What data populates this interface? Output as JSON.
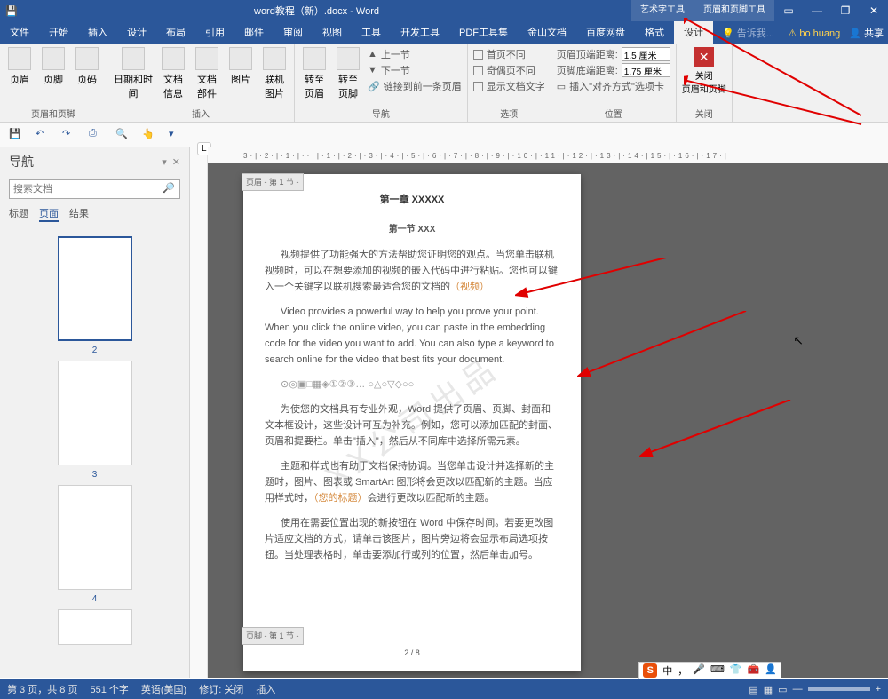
{
  "title": "word教程（新）.docx - Word",
  "contextual_tabs": [
    "艺术字工具",
    "页眉和页脚工具"
  ],
  "menu": [
    "文件",
    "开始",
    "插入",
    "设计",
    "布局",
    "引用",
    "邮件",
    "审阅",
    "视图",
    "工具",
    "开发工具",
    "PDF工具集",
    "金山文档",
    "百度网盘",
    "格式",
    "设计"
  ],
  "menu_active_index": 15,
  "tell_me_placeholder": "告诉我...",
  "user_name": "bo huang",
  "share_label": "共享",
  "ribbon": {
    "hf": {
      "header": "页眉",
      "footer": "页脚",
      "pagenum": "页码",
      "group": "页眉和页脚"
    },
    "insert": {
      "datetime": "日期和时间",
      "docinfo": "文档信息",
      "docpart": "文档部件",
      "picture": "图片",
      "online": "联机图片",
      "group": "插入"
    },
    "goto": {
      "gohdr": "转至页眉",
      "goftr": "转至页脚",
      "prev": "上一节",
      "next": "下一节",
      "link": "链接到前一条页眉",
      "group": "导航"
    },
    "options": {
      "first": "首页不同",
      "odd": "奇偶页不同",
      "showtxt": "显示文档文字",
      "align": "插入\"对齐方式\"选项卡",
      "group": "选项"
    },
    "position": {
      "top": "页眉顶端距离:",
      "bottom": "页脚底端距离:",
      "topv": "1.5 厘米",
      "botv": "1.75 厘米",
      "group": "位置"
    },
    "close": {
      "label": "关闭\n页眉和页脚",
      "group": "关闭"
    }
  },
  "nav": {
    "title": "导航",
    "search_placeholder": "搜索文档",
    "tabs": [
      "标题",
      "页面",
      "结果"
    ],
    "tabs_active": 1,
    "thumbs": [
      "2",
      "3",
      "4"
    ]
  },
  "ruler_badge": "L",
  "doc": {
    "header_section": "页眉 - 第 1 节 -",
    "footer_section": "页脚 - 第 1 节 -",
    "chapter": "第一章  XXXXX",
    "section": "第一节  XXX",
    "p1": "视频提供了功能强大的方法帮助您证明您的观点。当您单击联机视频时，可以在想要添加的视频的嵌入代码中进行粘贴。您也可以键入一个关键字以联机搜索最适合您的文档的",
    "p1_orange": "（视频）",
    "p2": "Video provides a powerful way to help you prove your point. When you click the online video, you can paste in the embedding code for the video you want to add. You can also type a keyword to search online for the video that best fits your document.",
    "symbols": "⊙◎▣□▦◈①②③…  ○△○▽◇○○",
    "p3": "为使您的文档具有专业外观，Word 提供了页眉、页脚、封面和文本框设计，这些设计可互为补充。例如，您可以添加匹配的封面、页眉和提要栏。单击\"插入\"，然后从不同库中选择所需元素。",
    "p4a": "主题和样式也有助于文档保持协调。当您单击设计并选择新的主题时，图片、图表或 SmartArt 图形将会更改以匹配新的主题。当应用样式时，",
    "p4_orange": "（您的标题）",
    "p4b": "会进行更改以匹配新的主题。",
    "p5": "使用在需要位置出现的新按钮在 Word 中保存时间。若要更改图片适应文档的方式，请单击该图片，图片旁边将会显示布局选项按钮。当处理表格时，单击要添加行或列的位置，然后单击加号。",
    "watermark": "XX公司出品",
    "ftr_page": "2 / 8"
  },
  "status": {
    "page": "第 3 页，共 8 页",
    "words": "551 个字",
    "lang": "英语(美国)",
    "track": "修订: 关闭",
    "insert": "插入"
  },
  "ime_items": [
    "中",
    ",",
    "",
    "",
    "",
    "",
    ""
  ]
}
